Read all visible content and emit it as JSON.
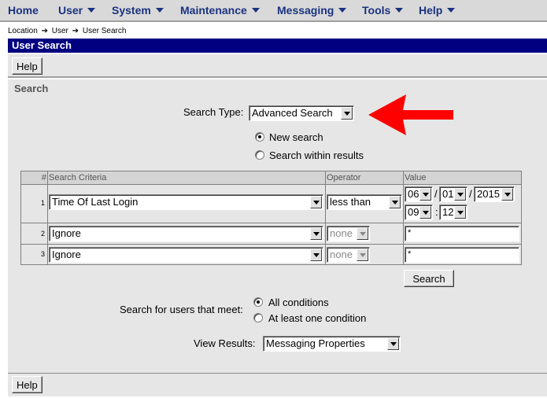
{
  "nav": {
    "home": "Home",
    "user": "User",
    "system": "System",
    "maintenance": "Maintenance",
    "messaging": "Messaging",
    "tools": "Tools",
    "help": "Help"
  },
  "breadcrumb": {
    "location": "Location",
    "user": "User",
    "user_search": "User Search"
  },
  "title": "User Search",
  "toolbar": {
    "help_label": "Help"
  },
  "section_title": "Search",
  "search_type": {
    "label": "Search Type:",
    "value": "Advanced Search"
  },
  "search_scope": {
    "new": "New search",
    "within": "Search within results",
    "selected": "New search"
  },
  "table": {
    "headers": {
      "num": "#",
      "criteria": "Search Criteria",
      "operator": "Operator",
      "value": "Value"
    },
    "rows": [
      {
        "num": "1",
        "criteria": "Time Of Last Login",
        "operator": "less than",
        "date": {
          "month": "06",
          "day": "01",
          "year": "2015",
          "sep1": "/",
          "sep2": "/"
        },
        "time": {
          "hour": "09",
          "minute": "12",
          "sep": ":"
        }
      },
      {
        "num": "2",
        "criteria": "Ignore",
        "operator": "none",
        "value": "*"
      },
      {
        "num": "3",
        "criteria": "Ignore",
        "operator": "none",
        "value": "*"
      }
    ]
  },
  "search_button": "Search",
  "match": {
    "label": "Search for users that meet:",
    "all": "All conditions",
    "any": "At least one condition",
    "selected": "All conditions"
  },
  "view_results": {
    "label": "View Results:",
    "value": "Messaging Properties"
  },
  "colors": {
    "title_bar": "#000080",
    "nav_text": "#1a3380",
    "arrow": "#ff0000"
  }
}
